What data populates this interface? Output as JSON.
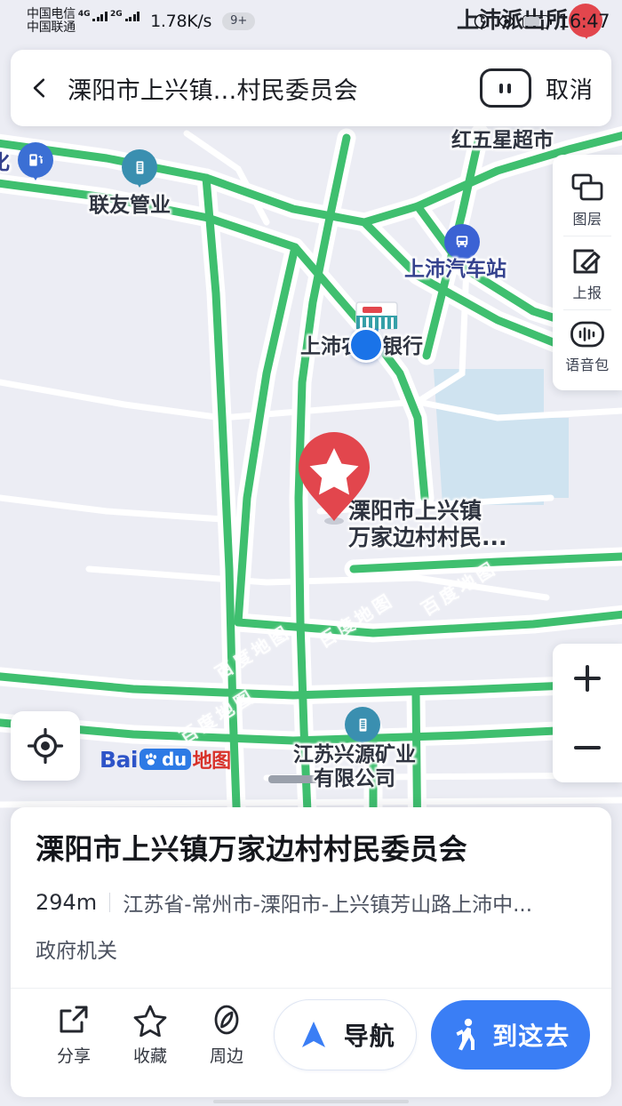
{
  "statusbar": {
    "carrier1": "中国电信",
    "carrier1_net": "4G",
    "carrier2": "中国联通",
    "carrier2_net": "2G",
    "speed": "1.78K/s",
    "notif_badge": "9+",
    "time": "16:47",
    "icons": [
      "alarm-icon",
      "eye-icon",
      "battery-icon"
    ]
  },
  "search": {
    "back_icon": "chevron-left-icon",
    "query": "溧阳市上兴镇...村民委员会",
    "voice_icon": "voice-search-icon",
    "cancel_label": "取消"
  },
  "toolpanel": {
    "items": [
      {
        "label": "图层",
        "icon": "layers-icon"
      },
      {
        "label": "上报",
        "icon": "report-edit-icon"
      },
      {
        "label": "语音包",
        "icon": "voice-package-icon"
      }
    ]
  },
  "zoom_control": {
    "zoom_in": "+",
    "zoom_out": "−"
  },
  "locate_button": {
    "icon": "crosshair-locate-icon"
  },
  "brand": {
    "bai": "Bai",
    "du": "du",
    "ditu": "地图"
  },
  "map": {
    "background_color": "#ecedf4",
    "road_color": "#3fbf6f",
    "water_color": "#cfe3f0",
    "selected_marker": {
      "icon": "star-pin-icon",
      "color": "#e2464d",
      "label_line1": "溧阳市上兴镇",
      "label_line2": "万家边村村民..."
    },
    "my_location": {
      "icon": "blue-dot-icon",
      "color": "#1a73e8"
    },
    "pois": [
      {
        "label": "化",
        "icon": "gas-station-icon",
        "color": "#3b6fd4"
      },
      {
        "label": "联友管业",
        "icon": "building-icon",
        "color": "#3a8fb0"
      },
      {
        "label": "红五星超市",
        "icon": "none"
      },
      {
        "label": "上沛汽车站",
        "icon": "bus-station-icon",
        "color": "#3b62d4"
      },
      {
        "label": "上沛农业银行",
        "icon": "bank-icon",
        "color": "#35a0a8"
      },
      {
        "label": "上沛派出所",
        "icon": "police-pin-icon",
        "color": "#e2464d"
      },
      {
        "label": "江苏兴源矿业",
        "label2": "有限公司",
        "icon": "building-icon",
        "color": "#3a8fb0"
      }
    ],
    "watermarks": [
      "百度地图",
      "百度地图",
      "百度地图",
      "百度地图"
    ]
  },
  "card": {
    "title": "溧阳市上兴镇万家边村村民委员会",
    "distance": "294m",
    "address": "江苏省-常州市-溧阳市-上兴镇芳山路上沛中...",
    "category": "政府机关",
    "actions": [
      {
        "label": "分享",
        "icon": "share-icon"
      },
      {
        "label": "收藏",
        "icon": "star-outline-icon"
      },
      {
        "label": "周边",
        "icon": "nearby-compass-icon"
      }
    ],
    "nav_button": {
      "label": "导航",
      "icon": "navigation-arrow-icon",
      "color": "#3a7ef5"
    },
    "go_button": {
      "label": "到这去",
      "icon": "walking-person-icon",
      "color": "#3a7ef5"
    }
  }
}
